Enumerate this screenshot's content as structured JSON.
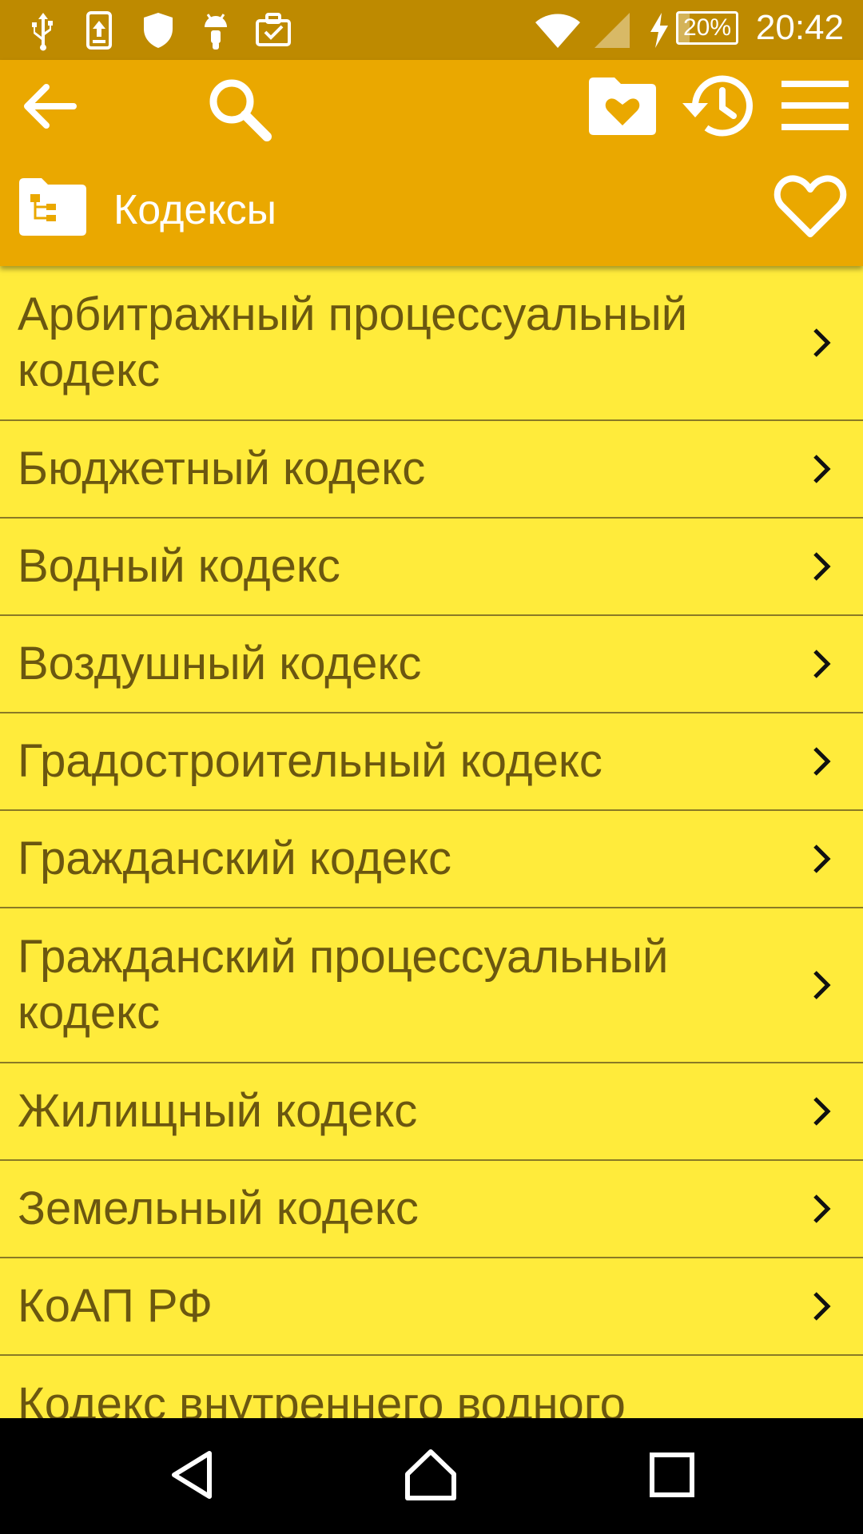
{
  "status_bar": {
    "time": "20:42",
    "battery": {
      "text": "20%",
      "level": 0.2
    },
    "icons": [
      "usb-icon",
      "upload-icon",
      "shield-icon",
      "android-icon",
      "briefcase-check-icon",
      "wifi-icon",
      "signal-icon",
      "charging-icon"
    ]
  },
  "toolbar": {
    "title": "Кодексы",
    "icons": [
      "back-arrow-icon",
      "search-icon",
      "favorites-folder-icon",
      "history-icon",
      "menu-icon",
      "folder-tree-icon",
      "heart-outline-icon"
    ]
  },
  "list": {
    "items": [
      {
        "label": "Арбитражный процессуальный кодекс"
      },
      {
        "label": "Бюджетный кодекс"
      },
      {
        "label": "Водный кодекс"
      },
      {
        "label": "Воздушный кодекс"
      },
      {
        "label": "Градостроительный кодекс"
      },
      {
        "label": "Гражданский кодекс"
      },
      {
        "label": "Гражданский процессуальный кодекс"
      },
      {
        "label": "Жилищный кодекс"
      },
      {
        "label": "Земельный кодекс"
      },
      {
        "label": "КоАП РФ"
      },
      {
        "label": "Кодекс внутреннего водного транспорта"
      }
    ]
  },
  "nav_bar": {
    "icons": [
      "nav-back-icon",
      "nav-home-icon",
      "nav-recents-icon"
    ]
  },
  "colors": {
    "status_bar": "#BE8A00",
    "toolbar": "#EAA800",
    "list_background": "#FFEB3B",
    "list_text": "#6B5710",
    "divider": "#8A7A25"
  }
}
